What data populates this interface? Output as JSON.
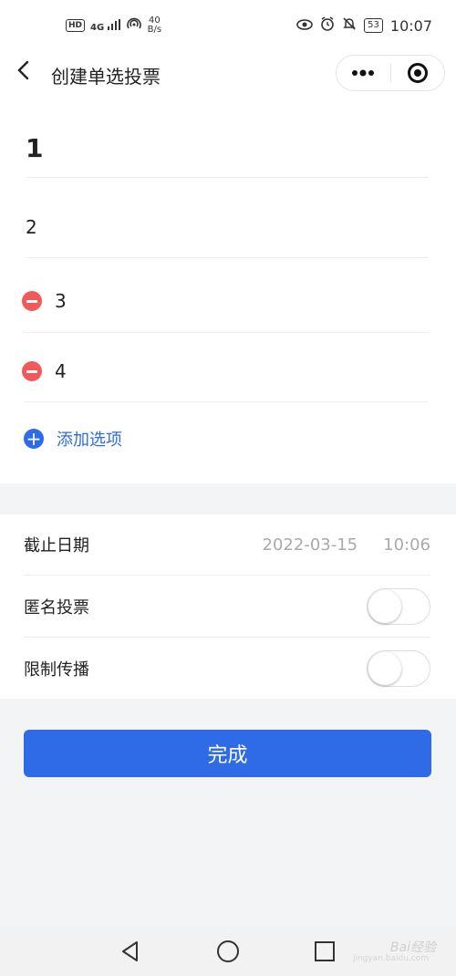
{
  "status": {
    "left_badge": "HD",
    "signal": "4G",
    "net_speed_value": "40",
    "net_speed_unit": "B/s",
    "battery": "53",
    "time": "10:07"
  },
  "navbar": {
    "title": "创建单选投票"
  },
  "options": [
    {
      "text": "1"
    },
    {
      "text": "2"
    },
    {
      "text": "3"
    },
    {
      "text": "4"
    }
  ],
  "add_option_label": "添加选项",
  "settings": {
    "deadline_label": "截止日期",
    "deadline_date": "2022-03-15",
    "deadline_time": "10:06",
    "anonymous_label": "匿名投票",
    "anonymous_on": false,
    "limit_share_label": "限制传播",
    "limit_share_on": false
  },
  "done_label": "完成",
  "watermark": {
    "brand": "Bai经验",
    "url": "jingyan.baidu.com"
  },
  "colors": {
    "primary": "#2f6be6",
    "remove": "#f05a5a",
    "background": "#f3f4f6"
  }
}
